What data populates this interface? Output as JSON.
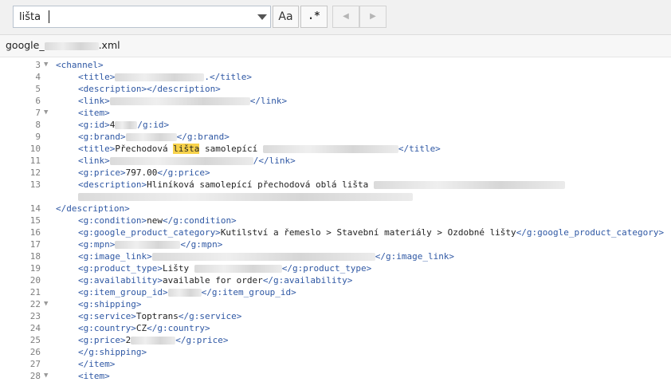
{
  "search": {
    "value": "lišta",
    "case_label": "Aa",
    "regex_label": ".*",
    "prev_label": "◀",
    "next_label": "▶"
  },
  "tab": {
    "prefix": "google_",
    "suffix": ".xml"
  },
  "lines": [
    {
      "n": "3",
      "fold": true,
      "indent": 0,
      "parts": [
        [
          "tag",
          "<channel>"
        ]
      ]
    },
    {
      "n": "4",
      "fold": false,
      "indent": 4,
      "parts": [
        [
          "tag",
          "<title>"
        ],
        [
          "redact",
          ""
        ],
        [
          "tag",
          ".</title>"
        ]
      ]
    },
    {
      "n": "5",
      "fold": false,
      "indent": 4,
      "parts": [
        [
          "tag",
          "<description></description>"
        ]
      ]
    },
    {
      "n": "6",
      "fold": false,
      "indent": 4,
      "parts": [
        [
          "tag",
          "<link>"
        ],
        [
          "redact",
          ""
        ],
        [
          "tag",
          "</link>"
        ]
      ]
    },
    {
      "n": "7",
      "fold": true,
      "indent": 4,
      "parts": [
        [
          "tag",
          "<item>"
        ]
      ]
    },
    {
      "n": "8",
      "fold": false,
      "indent": 4,
      "parts": [
        [
          "tag",
          "<g:id>"
        ],
        [
          "txt",
          "4"
        ],
        [
          "redact",
          ""
        ],
        [
          "tag",
          "/g:id>"
        ]
      ]
    },
    {
      "n": "9",
      "fold": false,
      "indent": 4,
      "parts": [
        [
          "tag",
          "<g:brand>"
        ],
        [
          "redact",
          ""
        ],
        [
          "tag",
          "</g:brand>"
        ]
      ]
    },
    {
      "n": "10",
      "fold": false,
      "indent": 4,
      "parts": [
        [
          "tag",
          "<title>"
        ],
        [
          "txt",
          "Přechodová "
        ],
        [
          "hl",
          "lišta"
        ],
        [
          "txt",
          " samolepící "
        ],
        [
          "redact",
          ""
        ],
        [
          "tag",
          "</title>"
        ]
      ]
    },
    {
      "n": "11",
      "fold": false,
      "indent": 4,
      "parts": [
        [
          "tag",
          "<link>"
        ],
        [
          "redact",
          ""
        ],
        [
          "tag",
          "/</link>"
        ]
      ]
    },
    {
      "n": "12",
      "fold": false,
      "indent": 4,
      "parts": [
        [
          "tag",
          "<g:price>"
        ],
        [
          "txt",
          "797.00"
        ],
        [
          "tag",
          "</g:price>"
        ]
      ]
    },
    {
      "n": "13",
      "fold": false,
      "indent": 4,
      "parts": [
        [
          "tag",
          "<description>"
        ],
        [
          "txt",
          "Hliníková samolepící přechodová oblá lišta "
        ],
        [
          "redact",
          ""
        ]
      ]
    },
    {
      "n": "",
      "fold": false,
      "indent": 4,
      "parts": [
        [
          "redact",
          ""
        ]
      ]
    },
    {
      "n": "14",
      "fold": false,
      "indent": 0,
      "parts": [
        [
          "tag",
          "</description>"
        ]
      ]
    },
    {
      "n": "15",
      "fold": false,
      "indent": 4,
      "parts": [
        [
          "tag",
          "<g:condition>"
        ],
        [
          "txt",
          "new"
        ],
        [
          "tag",
          "</g:condition>"
        ]
      ]
    },
    {
      "n": "16",
      "fold": false,
      "indent": 4,
      "parts": [
        [
          "tag",
          "<g:google_product_category>"
        ],
        [
          "txt",
          "Kutilství a řemeslo > Stavební materiály > Ozdobné lišty"
        ],
        [
          "tag",
          "</g:google_product_category>"
        ]
      ]
    },
    {
      "n": "17",
      "fold": false,
      "indent": 4,
      "parts": [
        [
          "tag",
          "<g:mpn>"
        ],
        [
          "redact",
          ""
        ],
        [
          "tag",
          "</g:mpn>"
        ]
      ]
    },
    {
      "n": "18",
      "fold": false,
      "indent": 4,
      "parts": [
        [
          "tag",
          "<g:image_link>"
        ],
        [
          "redact",
          ""
        ],
        [
          "tag",
          "</g:image_link>"
        ]
      ]
    },
    {
      "n": "19",
      "fold": false,
      "indent": 4,
      "parts": [
        [
          "tag",
          "<g:product_type>"
        ],
        [
          "txt",
          "Lišty "
        ],
        [
          "redact",
          ""
        ],
        [
          "tag",
          "</g:product_type>"
        ]
      ]
    },
    {
      "n": "20",
      "fold": false,
      "indent": 4,
      "parts": [
        [
          "tag",
          "<g:availability>"
        ],
        [
          "txt",
          "available for order"
        ],
        [
          "tag",
          "</g:availability>"
        ]
      ]
    },
    {
      "n": "21",
      "fold": false,
      "indent": 4,
      "parts": [
        [
          "tag",
          "<g:item_group_id>"
        ],
        [
          "redact",
          ""
        ],
        [
          "tag",
          "</g:item_group_id>"
        ]
      ]
    },
    {
      "n": "22",
      "fold": true,
      "indent": 4,
      "parts": [
        [
          "tag",
          "<g:shipping>"
        ]
      ]
    },
    {
      "n": "23",
      "fold": false,
      "indent": 4,
      "parts": [
        [
          "tag",
          "<g:service>"
        ],
        [
          "txt",
          "Toptrans"
        ],
        [
          "tag",
          "</g:service>"
        ]
      ]
    },
    {
      "n": "24",
      "fold": false,
      "indent": 4,
      "parts": [
        [
          "tag",
          "<g:country>"
        ],
        [
          "txt",
          "CZ"
        ],
        [
          "tag",
          "</g:country>"
        ]
      ]
    },
    {
      "n": "25",
      "fold": false,
      "indent": 4,
      "parts": [
        [
          "tag",
          "<g:price>"
        ],
        [
          "txt",
          "2"
        ],
        [
          "redact",
          ""
        ],
        [
          "tag",
          "</g:price>"
        ]
      ]
    },
    {
      "n": "26",
      "fold": false,
      "indent": 4,
      "parts": [
        [
          "tag",
          "</g:shipping>"
        ]
      ]
    },
    {
      "n": "27",
      "fold": false,
      "indent": 4,
      "parts": [
        [
          "tag",
          "</item>"
        ]
      ]
    },
    {
      "n": "28",
      "fold": true,
      "indent": 4,
      "parts": [
        [
          "tag",
          "<item>"
        ]
      ]
    }
  ]
}
